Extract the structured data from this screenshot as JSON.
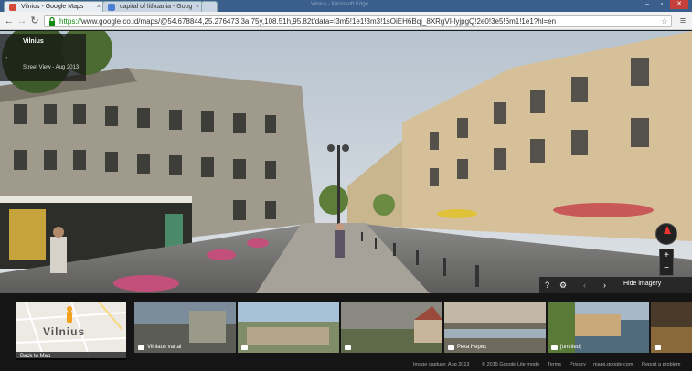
{
  "tabs": [
    {
      "title": "Vilnius - Google Maps",
      "active": true,
      "favicon_color": "#d44b3a"
    },
    {
      "title": "capital of lithuania - Goog",
      "active": false,
      "favicon_color": "#4a7fd4"
    }
  ],
  "window_title_ghost": "Vilnius - Microsoft Edge",
  "toolbar": {
    "back": "←",
    "forward": "→",
    "reload": "↻",
    "url_secure": "https://",
    "url_rest": "www.google.co.id/maps/@54.678844,25.276473,3a,75y,108.51h,95.82t/data=!3m5!1e1!3m3!1sOiEH6Bqj_8XRgVI-lyjpgQ!2e0!3e5!6m1!1e1?hl=en",
    "star_icon": "☆",
    "menu_icon": "≡"
  },
  "infocard": {
    "title": "Vilnius",
    "subtitle": "Street View - Aug 2013"
  },
  "controls": {
    "help": "?",
    "settings": "⚙",
    "prev": "‹",
    "next": "›",
    "hide_imagery": "Hide imagery"
  },
  "zoom": {
    "in": "+",
    "out": "−"
  },
  "minimap": {
    "label": "Vilnius",
    "back_label": "Back to Map"
  },
  "thumbnails": [
    {
      "caption": "Vilniaus vartai",
      "colors": [
        "#7d8c9a",
        "#5a5c55"
      ]
    },
    {
      "caption": "",
      "colors": [
        "#a9c1d6",
        "#7f8c68"
      ]
    },
    {
      "caption": "",
      "colors": [
        "#8b8a82",
        "#5e6a4a"
      ]
    },
    {
      "caption": "Река Нерис",
      "colors": [
        "#c1b8a8",
        "#6f6a5e"
      ]
    },
    {
      "caption": "[untitled]",
      "colors": [
        "#a7b9c9",
        "#4f6b7c"
      ]
    },
    {
      "caption": "",
      "colors": [
        "#4a3a2a",
        "#8a6a3a"
      ]
    }
  ],
  "footer": {
    "capture": "Image capture: Aug 2013",
    "copyright": "© 2015 Google",
    "lite": "Lite mode",
    "terms": "Terms",
    "privacy": "Privacy",
    "site": "maps.google.com",
    "report": "Report a problem"
  },
  "colors": {
    "tabstrip": "#3a5f8c",
    "secure_green": "#128a12",
    "pegman_orange": "#f4a11e"
  }
}
